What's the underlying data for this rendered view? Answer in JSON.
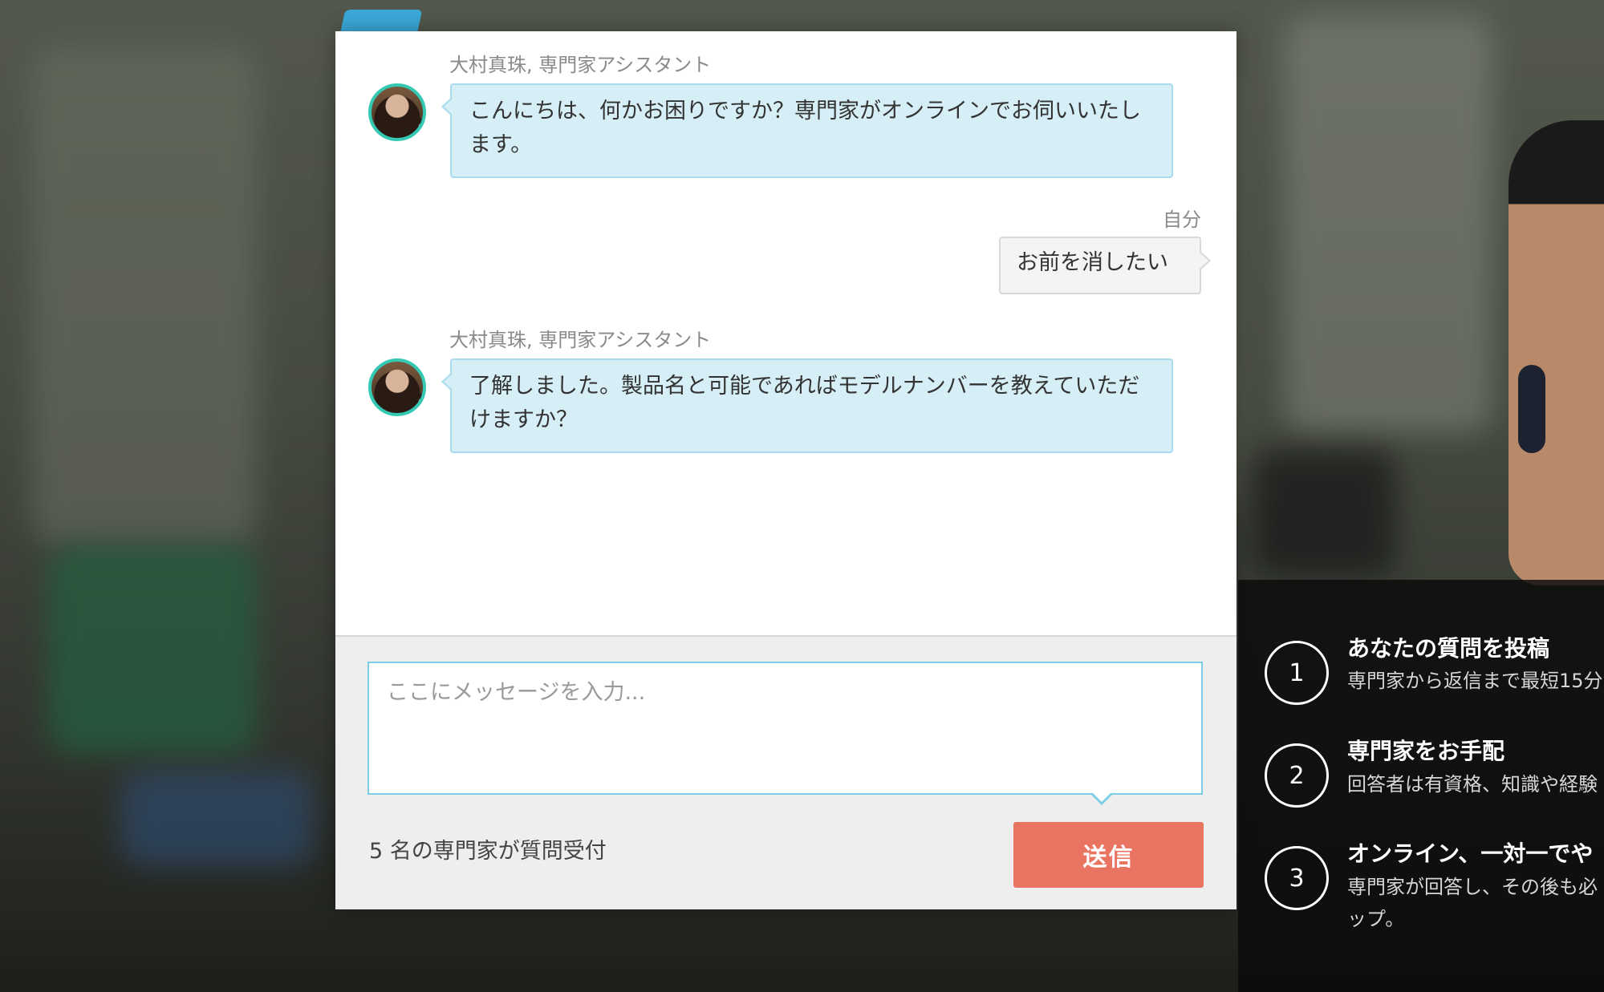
{
  "background": {
    "brand_text": "",
    "accent_color": "#3ba8d8"
  },
  "chat": {
    "messages": [
      {
        "sender": "大村真珠, 専門家アシスタント",
        "role": "agent",
        "text": "こんにちは、何かお困りですか？専門家がオンラインでお伺いいたします。"
      },
      {
        "sender": "自分",
        "role": "user",
        "text": "お前を消したい"
      },
      {
        "sender": "大村真珠, 専門家アシスタント",
        "role": "agent",
        "text": "了解しました。製品名と可能であればモデルナンバーを教えていただけますか？"
      }
    ],
    "input": {
      "value": "",
      "placeholder": "ここにメッセージを入力..."
    },
    "experts_status": "5 名の専門家が質問受付",
    "send_label": "送信"
  },
  "info_panel": {
    "steps": [
      {
        "number": "1",
        "title": "あなたの質問を投稿",
        "desc_lines": [
          "専門家から返信まで最短15分"
        ]
      },
      {
        "number": "2",
        "title": "専門家をお手配",
        "desc_lines": [
          "回答者は有資格、知識や経験"
        ]
      },
      {
        "number": "3",
        "title": "オンライン、一対一でや",
        "desc_lines": [
          "専門家が回答し、その後も必",
          "ップ。"
        ]
      }
    ]
  },
  "colors": {
    "agent_bubble": "#d6eef5",
    "avatar_ring": "#35c9b4",
    "send_button": "#ea7462",
    "input_border": "#7ccde8"
  }
}
